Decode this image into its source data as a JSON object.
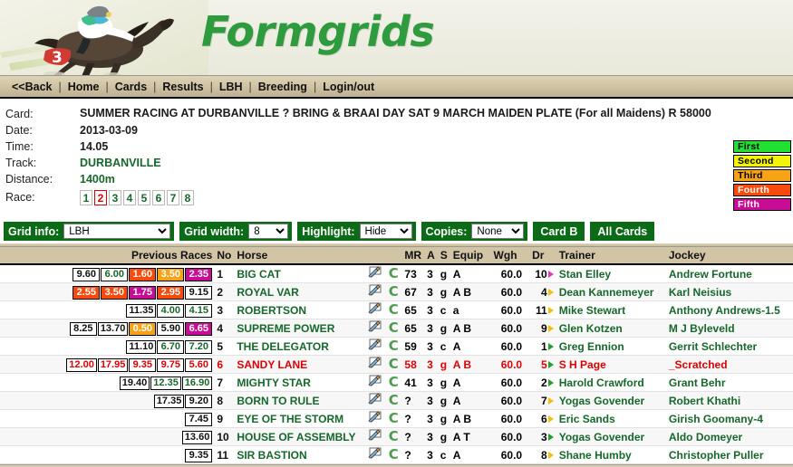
{
  "banner": {
    "title": "Formgrids",
    "brand_color": "#2e9b3f"
  },
  "nav": {
    "items": [
      {
        "label": "<<Back"
      },
      {
        "label": "Home"
      },
      {
        "label": "Cards"
      },
      {
        "label": "Results"
      },
      {
        "label": "LBH"
      },
      {
        "label": "Breeding"
      },
      {
        "label": "Login/out"
      }
    ],
    "separator": "|"
  },
  "card_info": {
    "card_label": "Card:",
    "card_value": "SUMMER RACING AT DURBANVILLE ? BRING & BRAAI DAY SAT 9 MARCH MAIDEN PLATE (For all Maidens) R 58000",
    "date_label": "Date:",
    "date_value": "2013-03-09",
    "time_label": "Time:",
    "time_value": "14.05",
    "track_label": "Track:",
    "track_value": "DURBANVILLE",
    "distance_label": "Distance:",
    "distance_value": "1400m",
    "race_label": "Race:",
    "race_numbers": [
      "1",
      "2",
      "3",
      "4",
      "5",
      "6",
      "7",
      "8"
    ],
    "race_selected": "2"
  },
  "legend": [
    {
      "label": "First",
      "bg": "#22e032",
      "fg": "#000000"
    },
    {
      "label": "Second",
      "bg": "#f4f40a",
      "fg": "#000000"
    },
    {
      "label": "Third",
      "bg": "#f7a317",
      "fg": "#000000"
    },
    {
      "label": "Fourth",
      "bg": "#f84a0c",
      "fg": "#ffffff"
    },
    {
      "label": "Fifth",
      "bg": "#c80c96",
      "fg": "#ffffff"
    }
  ],
  "toolbar": {
    "grid_info_label": "Grid info:",
    "grid_info_value": "LBH",
    "grid_info_options": [
      "LBH"
    ],
    "grid_width_label": "Grid width:",
    "grid_width_value": "8",
    "grid_width_options": [
      "8"
    ],
    "highlight_label": "Highlight:",
    "highlight_value": "Hide",
    "highlight_options": [
      "Hide"
    ],
    "copies_label": "Copies:",
    "copies_value": "None",
    "copies_options": [
      "None"
    ],
    "card_b_label": "Card B",
    "all_cards_label": "All Cards"
  },
  "grid": {
    "columns": {
      "previous_races": "Previous Races",
      "no": "No",
      "horse": "Horse",
      "mr": "MR",
      "a": "A",
      "s": "S",
      "equip": "Equip",
      "wgh": "Wgh",
      "dr": "Dr",
      "trainer": "Trainer",
      "jockey": "Jockey"
    },
    "note_icon": "note-pencil-icon",
    "c_badge": "C",
    "rows": [
      {
        "forms": [
          {
            "v": "9.60",
            "bg": "#ffffff",
            "fg": "#111111"
          },
          {
            "v": "6.00",
            "bg": "#ffffff",
            "fg": "#15682a"
          },
          {
            "v": "1.60",
            "bg": "#f84a0c",
            "fg": "#ffffff"
          },
          {
            "v": "3.50",
            "bg": "#f7a317",
            "fg": "#ffffff"
          },
          {
            "v": "2.35",
            "bg": "#c80c96",
            "fg": "#ffffff"
          }
        ],
        "no": "1",
        "horse": "BIG CAT",
        "mr": "73",
        "a": "3",
        "s": "g",
        "equip": "A",
        "wgh": "60.0",
        "dr": "10",
        "dr_color": "#e23bbf",
        "trainer": "Stan Elley",
        "jockey": "Andrew Fortune",
        "scratched": false
      },
      {
        "forms": [
          {
            "v": "2.55",
            "bg": "#f84a0c",
            "fg": "#ffffff"
          },
          {
            "v": "3.50",
            "bg": "#f84a0c",
            "fg": "#ffffff"
          },
          {
            "v": "1.75",
            "bg": "#c80c96",
            "fg": "#ffffff"
          },
          {
            "v": "2.95",
            "bg": "#f84a0c",
            "fg": "#ffffff"
          },
          {
            "v": "9.15",
            "bg": "#ffffff",
            "fg": "#111111"
          }
        ],
        "no": "2",
        "horse": "ROYAL VAR",
        "mr": "67",
        "a": "3",
        "s": "g",
        "equip": "A B",
        "wgh": "60.0",
        "dr": "4",
        "dr_color": "#f2c00a",
        "trainer": "Dean Kannemeyer",
        "jockey": "Karl Neisius",
        "scratched": false
      },
      {
        "forms": [
          {
            "v": "11.35",
            "bg": "#ffffff",
            "fg": "#111111"
          },
          {
            "v": "4.00",
            "bg": "#ffffff",
            "fg": "#15682a"
          },
          {
            "v": "4.15",
            "bg": "#ffffff",
            "fg": "#15682a"
          }
        ],
        "no": "3",
        "horse": "ROBERTSON",
        "mr": "65",
        "a": "3",
        "s": "c",
        "equip": "a",
        "wgh": "60.0",
        "dr": "11",
        "dr_color": "#f2c00a",
        "trainer": "Mike Stewart",
        "jockey": "Anthony Andrews-1.5",
        "scratched": false
      },
      {
        "forms": [
          {
            "v": "8.25",
            "bg": "#ffffff",
            "fg": "#111111"
          },
          {
            "v": "13.70",
            "bg": "#ffffff",
            "fg": "#111111"
          },
          {
            "v": "0.50",
            "bg": "#f7a317",
            "fg": "#ffffff"
          },
          {
            "v": "5.90",
            "bg": "#ffffff",
            "fg": "#111111"
          },
          {
            "v": "6.65",
            "bg": "#c80c96",
            "fg": "#ffffff"
          }
        ],
        "no": "4",
        "horse": "SUPREME POWER",
        "mr": "65",
        "a": "3",
        "s": "g",
        "equip": "A B",
        "wgh": "60.0",
        "dr": "9",
        "dr_color": "#f2c00a",
        "trainer": "Glen Kotzen",
        "jockey": "M J Byleveld",
        "scratched": false
      },
      {
        "forms": [
          {
            "v": "11.10",
            "bg": "#ffffff",
            "fg": "#111111"
          },
          {
            "v": "6.70",
            "bg": "#ffffff",
            "fg": "#15682a"
          },
          {
            "v": "7.20",
            "bg": "#ffffff",
            "fg": "#15682a"
          }
        ],
        "no": "5",
        "horse": "THE DELEGATOR",
        "mr": "59",
        "a": "3",
        "s": "c",
        "equip": "A",
        "wgh": "60.0",
        "dr": "1",
        "dr_color": "#22a02a",
        "trainer": "Greg Ennion",
        "jockey": "Gerrit Schlechter",
        "scratched": false
      },
      {
        "forms": [
          {
            "v": "12.00",
            "bg": "#ffffff",
            "fg": "#e00000"
          },
          {
            "v": "17.95",
            "bg": "#ffffff",
            "fg": "#e00000"
          },
          {
            "v": "9.35",
            "bg": "#ffffff",
            "fg": "#e00000"
          },
          {
            "v": "9.75",
            "bg": "#ffffff",
            "fg": "#e00000"
          },
          {
            "v": "5.60",
            "bg": "#ffffff",
            "fg": "#e00000"
          }
        ],
        "no": "6",
        "horse": "SANDY LANE",
        "mr": "58",
        "a": "3",
        "s": "g",
        "equip": "A B",
        "wgh": "60.0",
        "dr": "5",
        "dr_color": "#22a02a",
        "trainer": "S H Page",
        "jockey": "_Scratched",
        "scratched": true
      },
      {
        "forms": [
          {
            "v": "19.40",
            "bg": "#ffffff",
            "fg": "#111111"
          },
          {
            "v": "12.35",
            "bg": "#ffffff",
            "fg": "#15682a"
          },
          {
            "v": "16.90",
            "bg": "#ffffff",
            "fg": "#15682a"
          }
        ],
        "no": "7",
        "horse": "MIGHTY STAR",
        "mr": "41",
        "a": "3",
        "s": "g",
        "equip": "A",
        "wgh": "60.0",
        "dr": "2",
        "dr_color": "#22a02a",
        "trainer": "Harold Crawford",
        "jockey": "Grant Behr",
        "scratched": false
      },
      {
        "forms": [
          {
            "v": "17.35",
            "bg": "#ffffff",
            "fg": "#111111"
          },
          {
            "v": "9.20",
            "bg": "#ffffff",
            "fg": "#111111"
          }
        ],
        "no": "8",
        "horse": "BORN TO RULE",
        "mr": "?",
        "a": "3",
        "s": "g",
        "equip": "A",
        "wgh": "60.0",
        "dr": "7",
        "dr_color": "#f2c00a",
        "trainer": "Yogas Govender",
        "jockey": "Robert Khathi",
        "scratched": false
      },
      {
        "forms": [
          {
            "v": "7.45",
            "bg": "#ffffff",
            "fg": "#111111"
          }
        ],
        "no": "9",
        "horse": "EYE OF THE STORM",
        "mr": "?",
        "a": "3",
        "s": "g",
        "equip": "A B",
        "wgh": "60.0",
        "dr": "6",
        "dr_color": "#f2c00a",
        "trainer": "Eric Sands",
        "jockey": "Girish Goomany-4",
        "scratched": false
      },
      {
        "forms": [
          {
            "v": "13.60",
            "bg": "#ffffff",
            "fg": "#111111"
          }
        ],
        "no": "10",
        "horse": "HOUSE OF ASSEMBLY",
        "mr": "?",
        "a": "3",
        "s": "g",
        "equip": "A T",
        "wgh": "60.0",
        "dr": "3",
        "dr_color": "#22a02a",
        "trainer": "Yogas Govender",
        "jockey": "Aldo Domeyer",
        "scratched": false
      },
      {
        "forms": [
          {
            "v": "9.35",
            "bg": "#ffffff",
            "fg": "#111111"
          }
        ],
        "no": "11",
        "horse": "SIR BASTION",
        "mr": "?",
        "a": "3",
        "s": "c",
        "equip": "A",
        "wgh": "60.0",
        "dr": "8",
        "dr_color": "#f2c00a",
        "trainer": "Shane Humby",
        "jockey": "Christopher Puller",
        "scratched": false
      }
    ]
  }
}
